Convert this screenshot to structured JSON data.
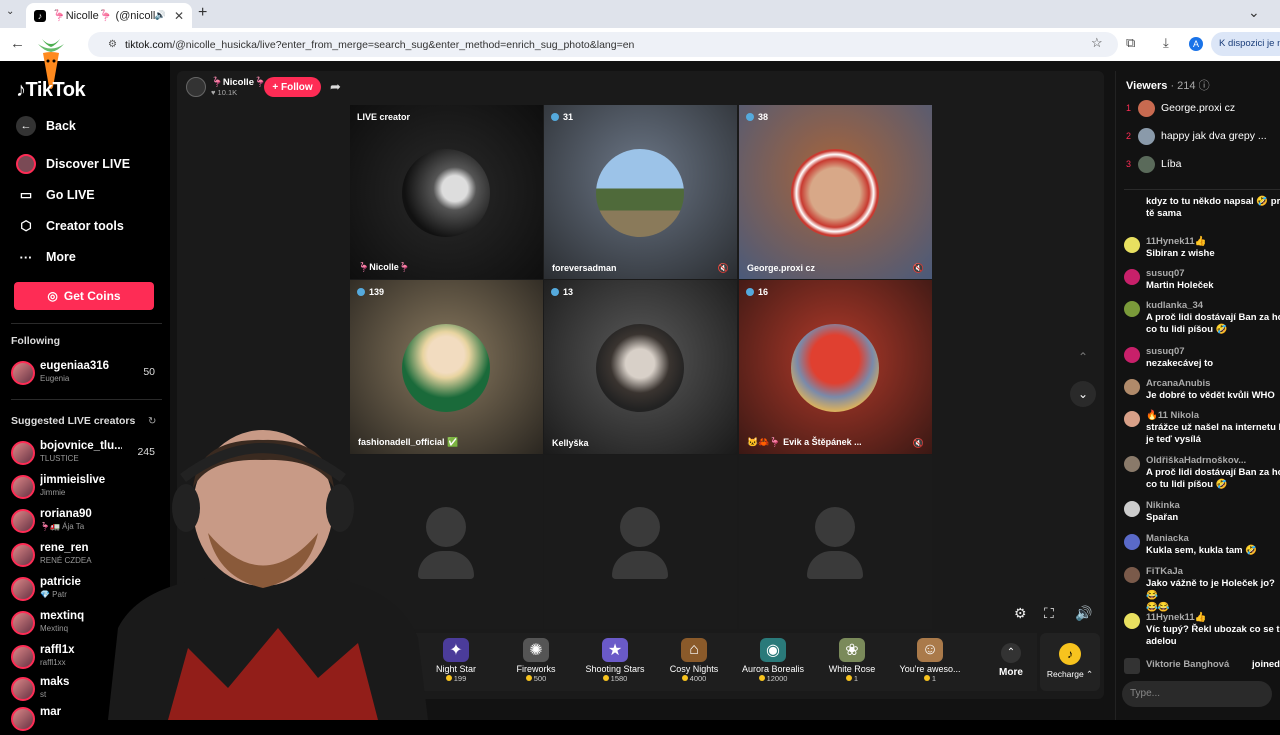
{
  "browser": {
    "tab_title": "🦩Nicolle🦩 (@nicolle_hu",
    "url_host": "tiktok.com",
    "url_path": "/@nicolle_husicka/live?enter_from_merge=search_sug&enter_method=enrich_sug_photo&lang=en",
    "profile_initial": "A",
    "right_button": "K dispozici je nová"
  },
  "sidebar": {
    "logo": "TikTok",
    "items": [
      {
        "label": "Back",
        "icon": "back-arrow-icon"
      },
      {
        "label": "Discover LIVE",
        "icon": "live-avatar-icon"
      },
      {
        "label": "Go LIVE",
        "icon": "video-camera-icon"
      },
      {
        "label": "Creator tools",
        "icon": "creator-tools-icon"
      },
      {
        "label": "More",
        "icon": "more-dots-icon"
      }
    ],
    "coins_label": "Get Coins",
    "following_header": "Following",
    "following": [
      {
        "name": "eugeniaa316",
        "sub": "Eugenia",
        "count": "50"
      }
    ],
    "suggested_header": "Suggested LIVE creators",
    "suggested": [
      {
        "name": "bojovnice_tlu...",
        "sub": "TLUSTICE",
        "count": "245"
      },
      {
        "name": "jimmieislive",
        "sub": "Jimmie",
        "count": ""
      },
      {
        "name": "roriana90",
        "sub": "🦩🚛 Ája Ta",
        "count": ""
      },
      {
        "name": "rene_ren",
        "sub": "RENÉ CZDEA",
        "count": ""
      },
      {
        "name": "patricie",
        "sub": "💎 Patr",
        "count": ""
      },
      {
        "name": "mextinq",
        "sub": "Mextinq",
        "count": ""
      },
      {
        "name": "raffl1x",
        "sub": "raffl1xx",
        "count": ""
      },
      {
        "name": "maks",
        "sub": "st",
        "count": ""
      },
      {
        "name": "mar",
        "sub": "",
        "count": ""
      }
    ]
  },
  "stage": {
    "host_name": "🦩Nicolle🦩",
    "host_likes": "♥ 10.1K",
    "follow_label": "+ Follow",
    "cells": [
      {
        "count": "LIVE creator",
        "name": "🦩Nicolle🦩",
        "muted": false,
        "bg": "#1c1c1c",
        "circle": "#3b3b3b"
      },
      {
        "count": "31",
        "name": "foreversadman",
        "muted": true,
        "bg": "#3a4048",
        "circle": "#6d8aa6"
      },
      {
        "count": "38",
        "name": "George.proxi cz",
        "muted": true,
        "bg": "#7a4e3a",
        "circle": "#c85a40"
      },
      {
        "count": "139",
        "name": "fashionadell_official ✅",
        "muted": false,
        "bg": "#4a4236",
        "circle": "#d8cbb8"
      },
      {
        "count": "13",
        "name": "Kellyška",
        "muted": false,
        "bg": "#2e2e2e",
        "circle": "#5a5652"
      },
      {
        "count": "16",
        "name": "🐱🦀🦩 Evik a Štěpánek ...",
        "muted": true,
        "bg": "#6a2a22",
        "circle": "#c8503a"
      }
    ],
    "gifts": [
      {
        "name": "Night Star",
        "price": "199",
        "icon": "night-star-gift-icon",
        "glyph": "✦",
        "color": "#4b3c9a"
      },
      {
        "name": "Fireworks",
        "price": "500",
        "icon": "fireworks-gift-icon",
        "glyph": "✺",
        "color": "#555"
      },
      {
        "name": "Shooting Stars",
        "price": "1580",
        "icon": "shooting-stars-gift-icon",
        "glyph": "★",
        "color": "#6a5ac8"
      },
      {
        "name": "Cosy Nights",
        "price": "4000",
        "icon": "cosy-nights-gift-icon",
        "glyph": "⌂",
        "color": "#8a5a2a"
      },
      {
        "name": "Aurora Borealis",
        "price": "12000",
        "icon": "aurora-gift-icon",
        "glyph": "◉",
        "color": "#2a7a7a"
      },
      {
        "name": "White Rose",
        "price": "1",
        "icon": "white-rose-gift-icon",
        "glyph": "❀",
        "color": "#7a8a5a"
      },
      {
        "name": "You're aweso...",
        "price": "1",
        "icon": "youre-awesome-gift-icon",
        "glyph": "☺",
        "color": "#aa7a4a"
      }
    ],
    "more_label": "More",
    "recharge_label": "Recharge ⌃"
  },
  "chat": {
    "viewers_label": "Viewers",
    "viewers_count": "· 214",
    "top": [
      {
        "rank": "1",
        "name": "George.proxi cz"
      },
      {
        "rank": "2",
        "name": "happy jak dva grepy ..."
      },
      {
        "rank": "3",
        "name": "Líba"
      }
    ],
    "messages": [
      {
        "user": "",
        "text": "kdyz to tu někdo napsal 🤣 pr\ntě sama"
      },
      {
        "user": "11Hynek11👍",
        "text": "Sibiran z wishe"
      },
      {
        "user": "susuq07",
        "text": "Martin Holeček"
      },
      {
        "user": "kudlanka_34",
        "text": "A proč lidi dostávají Ban za ho\nco tu lidi píšou 🤣"
      },
      {
        "user": "susuq07",
        "text": "nezakecávej to"
      },
      {
        "user": "ArcanaAnubis",
        "text": "Je dobré to vědět kvůli WHO"
      },
      {
        "user": "🔥11 Nikola",
        "text": "strážce už našel na internetu l\nje teď vysílá"
      },
      {
        "user": "OldřiškaHadrnoškov...",
        "text": "A proč lidi dostávají Ban za ho\nco tu lidi píšou 🤣"
      },
      {
        "user": "Nikinka",
        "text": "Spařan"
      },
      {
        "user": "Maniacka",
        "text": "Kukla sem, kukla tam 🤣"
      },
      {
        "user": "FiTKaJa",
        "text": "Jako vážně to je Holeček jo?😂\n😂😂"
      },
      {
        "user": "11Hynek11👍",
        "text": "Víc tupý? Řekl ubozak co se t\nadelou"
      }
    ],
    "join_user": "Viktorie Banghová",
    "join_text": "joined",
    "type_placeholder": "Type..."
  },
  "colors": {
    "accent": "#fe2c55",
    "coin": "#f7c31e"
  }
}
